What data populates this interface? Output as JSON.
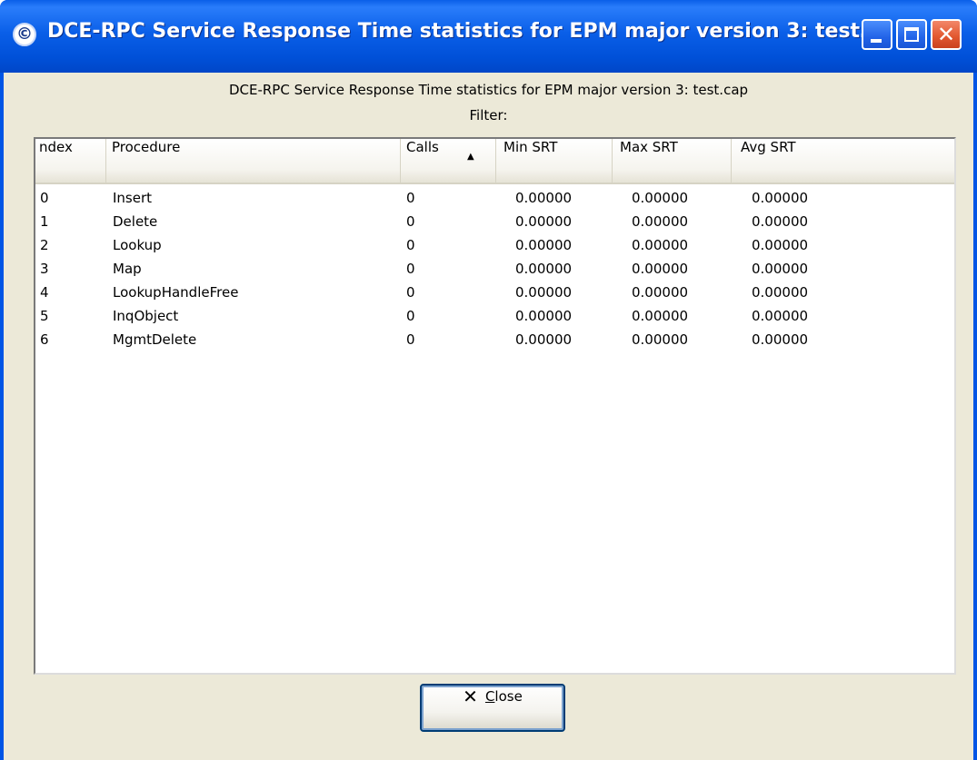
{
  "window": {
    "title": "DCE-RPC Service Response Time statistics for EPM major version 3: test…",
    "icon": "wireshark-app-icon",
    "controls": [
      "minimize",
      "maximize",
      "close"
    ]
  },
  "header": {
    "title": "DCE-RPC Service Response Time statistics for EPM major version 3: test.cap",
    "filter": "Filter:"
  },
  "table": {
    "columns": [
      "ndex",
      "Procedure",
      "Calls",
      "Min SRT",
      "Max SRT",
      "Avg SRT"
    ],
    "sorted_column": "Calls",
    "rows": [
      {
        "index": "0",
        "procedure": "Insert",
        "calls": "0",
        "min": "0.00000",
        "max": "0.00000",
        "avg": "0.00000"
      },
      {
        "index": "1",
        "procedure": "Delete",
        "calls": "0",
        "min": "0.00000",
        "max": "0.00000",
        "avg": "0.00000"
      },
      {
        "index": "2",
        "procedure": "Lookup",
        "calls": "0",
        "min": "0.00000",
        "max": "0.00000",
        "avg": "0.00000"
      },
      {
        "index": "3",
        "procedure": "Map",
        "calls": "0",
        "min": "0.00000",
        "max": "0.00000",
        "avg": "0.00000"
      },
      {
        "index": "4",
        "procedure": "LookupHandleFree",
        "calls": "0",
        "min": "0.00000",
        "max": "0.00000",
        "avg": "0.00000"
      },
      {
        "index": "5",
        "procedure": "InqObject",
        "calls": "0",
        "min": "0.00000",
        "max": "0.00000",
        "avg": "0.00000"
      },
      {
        "index": "6",
        "procedure": "MgmtDelete",
        "calls": "0",
        "min": "0.00000",
        "max": "0.00000",
        "avg": "0.00000"
      }
    ]
  },
  "close_button": {
    "label_first": "C",
    "label_rest": "lose",
    "icon": "close-x-icon"
  },
  "colors": {
    "titlebar": "#0055e5",
    "client_bg": "#ece9d8",
    "close_control": "#e35a32"
  }
}
